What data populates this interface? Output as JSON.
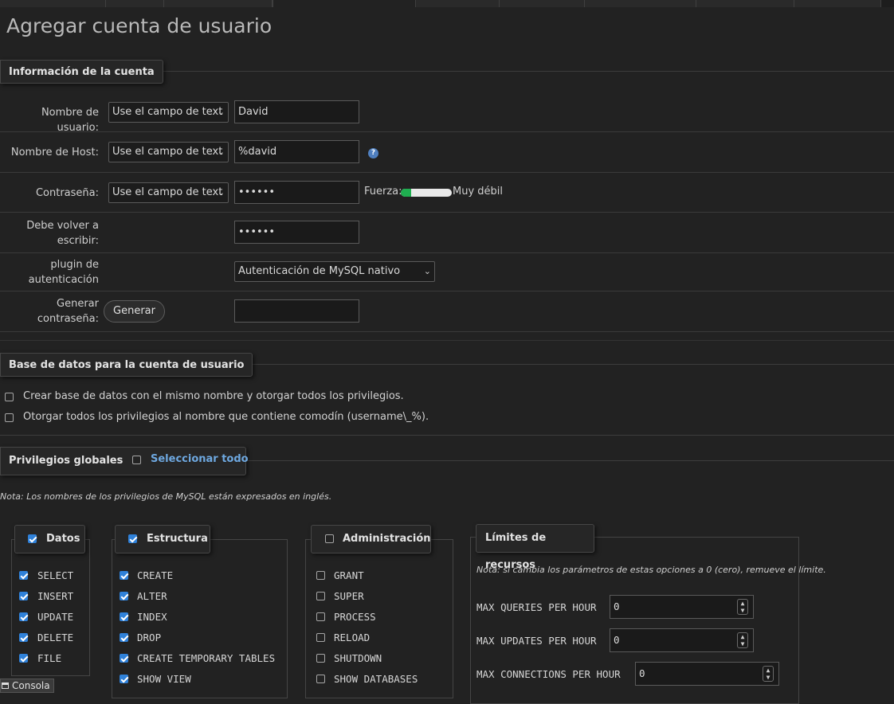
{
  "page": {
    "title": "Agregar cuenta de usuario"
  },
  "account": {
    "legend": "Información de la cuenta",
    "username_label": "Nombre de usuario:",
    "username_select": "Use el campo de text",
    "username_value": "David",
    "host_label": "Nombre de Host:",
    "host_select": "Use el campo de text",
    "host_value": "%david",
    "password_label": "Contraseña:",
    "password_select": "Use el campo de text",
    "password_value": "••••••",
    "strength_label": "Fuerza:",
    "strength_text": "Muy débil",
    "strength_level": 0.2,
    "retype_label": "Debe volver a escribir:",
    "retype_value": "••••••",
    "plugin_label": "plugin de autenticación",
    "plugin_select": "Autenticación de MySQL nativo",
    "generate_label": "Generar contraseña:",
    "generate_button": "Generar",
    "generated_value": ""
  },
  "database": {
    "legend": "Base de datos para la cuenta de usuario",
    "options": [
      {
        "label": "Crear base de datos con el mismo nombre y otorgar todos los privilegios.",
        "checked": false
      },
      {
        "label": "Otorgar todos los privilegios al nombre que contiene comodín (username\\_%).",
        "checked": false
      }
    ]
  },
  "privileges": {
    "legend": "Privilegios globales",
    "select_all": "Seleccionar todo",
    "note": "Nota: Los nombres de los privilegios de MySQL están expresados en inglés.",
    "data": {
      "title": "Datos",
      "checked": true,
      "items": [
        "SELECT",
        "INSERT",
        "UPDATE",
        "DELETE",
        "FILE"
      ]
    },
    "structure": {
      "title": "Estructura",
      "checked": true,
      "items": [
        "CREATE",
        "ALTER",
        "INDEX",
        "DROP",
        "CREATE TEMPORARY TABLES",
        "SHOW VIEW"
      ]
    },
    "admin": {
      "title": "Administración",
      "checked": false,
      "items": [
        "GRANT",
        "SUPER",
        "PROCESS",
        "RELOAD",
        "SHUTDOWN",
        "SHOW DATABASES"
      ]
    },
    "limits": {
      "title": "Límites de recursos",
      "note": "Nota: si cambia los parámetros de estas opciones a 0 (cero), remueve el límite.",
      "rows": [
        {
          "label": "MAX QUERIES PER HOUR",
          "value": "0"
        },
        {
          "label": "MAX UPDATES PER HOUR",
          "value": "0"
        },
        {
          "label": "MAX CONNECTIONS PER HOUR",
          "value": "0"
        }
      ]
    }
  },
  "footer": {
    "console": "Consola"
  },
  "colors": {
    "accent": "#2f81d9",
    "link": "#6ea8e0",
    "strength": "#1fae50",
    "background": "#222222"
  }
}
